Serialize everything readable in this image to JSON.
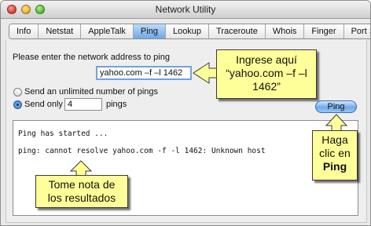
{
  "window": {
    "title": "Network Utility"
  },
  "tabs": [
    "Info",
    "Netstat",
    "AppleTalk",
    "Ping",
    "Lookup",
    "Traceroute",
    "Whois",
    "Finger",
    "Port Scan"
  ],
  "active_tab": "Ping",
  "ping": {
    "prompt": "Please enter the network address to ping",
    "address_value": "yahoo.com –f –l 1462",
    "unlimited_label": "Send an unlimited number of pings",
    "send_only_label": "Send only",
    "count_value": "4",
    "pings_label": "pings",
    "button_label": "Ping",
    "selected_option": "send_only"
  },
  "output": {
    "lines": [
      "Ping has started ...",
      "ping: cannot resolve yahoo.com -f -l 1462: Unknown host"
    ]
  },
  "callouts": {
    "enter": {
      "line1": "Ingrese aquí",
      "line2": "“yahoo.com –f –l",
      "line3": "1462”"
    },
    "click": {
      "line1": "Haga",
      "line2": "clic en",
      "line3": "Ping"
    },
    "results": {
      "line1": "Tome nota de",
      "line2": "los resultados"
    }
  },
  "colors": {
    "callout_fill": "#ffff99",
    "active_tab": "#6ea7e7",
    "focus_ring": "#6fa3de"
  }
}
